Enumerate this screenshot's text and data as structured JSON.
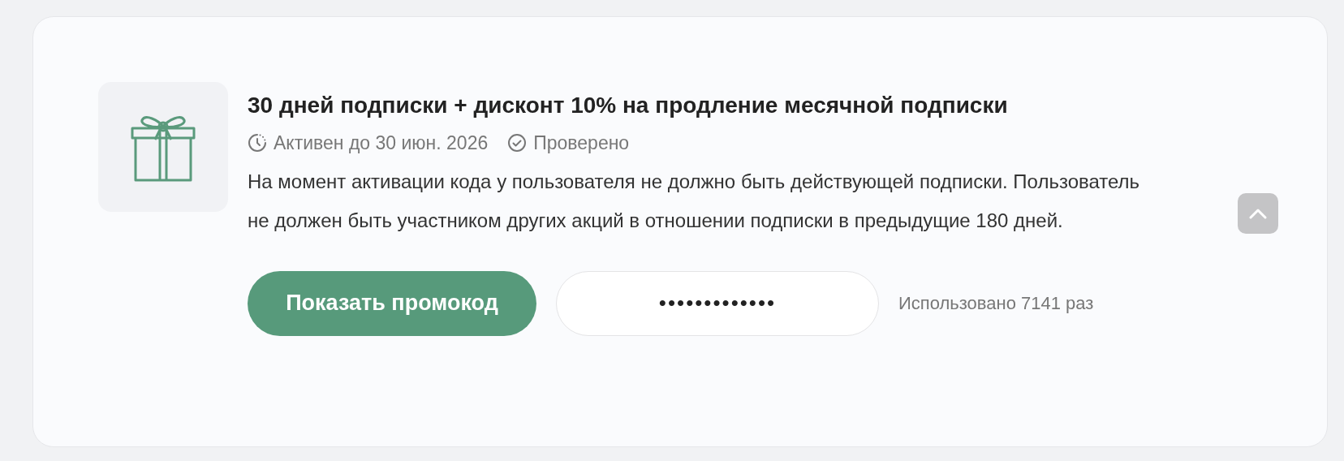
{
  "offer": {
    "title": "30 дней подписки + дисконт 10% на продление месячной подписки",
    "validity": "Активен до 30 июн. 2026",
    "verified_label": "Проверено",
    "verified": true,
    "description": "На момент активации кода у пользователя не должно быть действующей подписки. Пользователь не должен быть участником других акций в отношении подписки в предыдущие 180 дней.",
    "expanded": true,
    "show_button": "Показать промокод",
    "code": "•••••••••••••",
    "usage": "Использовано 7141 раз"
  }
}
